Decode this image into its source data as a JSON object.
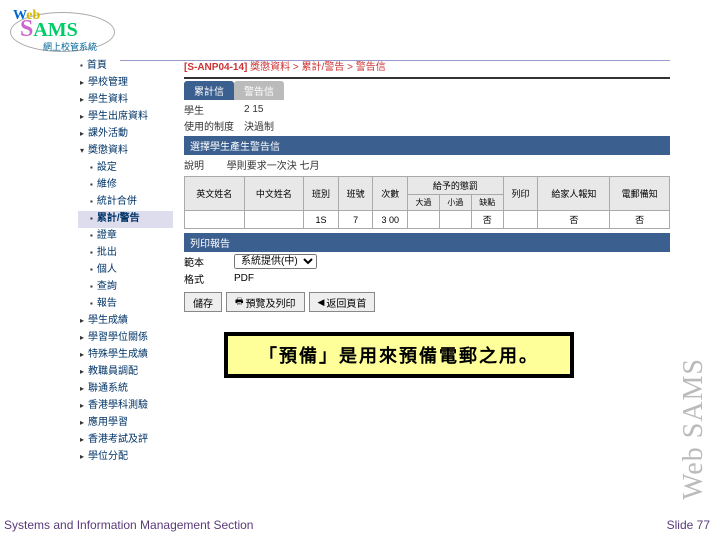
{
  "logo": {
    "web": "Web",
    "sams": "SAMS",
    "cn": "網上校管系統"
  },
  "sidebar": {
    "items": [
      {
        "label": "首頁",
        "type": "bullet"
      },
      {
        "label": "學校管理",
        "type": "arrow"
      },
      {
        "label": "學生資料",
        "type": "arrow"
      },
      {
        "label": "學生出席資料",
        "type": "arrow"
      },
      {
        "label": "課外活動",
        "type": "arrow"
      },
      {
        "label": "獎懲資料",
        "type": "open"
      },
      {
        "label": "設定",
        "type": "bullet",
        "child": true
      },
      {
        "label": "維修",
        "type": "bullet",
        "child": true
      },
      {
        "label": "統計合併",
        "type": "bullet",
        "child": true
      },
      {
        "label": "累計/警告",
        "type": "bullet",
        "child": true,
        "active": true
      },
      {
        "label": "證章",
        "type": "bullet",
        "child": true
      },
      {
        "label": "批出",
        "type": "bullet",
        "child": true
      },
      {
        "label": "個人",
        "type": "bullet",
        "child": true
      },
      {
        "label": "查詢",
        "type": "bullet",
        "child": true
      },
      {
        "label": "報告",
        "type": "bullet",
        "child": true
      },
      {
        "label": "學生成績",
        "type": "arrow"
      },
      {
        "label": "學習學位關係",
        "type": "arrow"
      },
      {
        "label": "特殊學生成績",
        "type": "arrow"
      },
      {
        "label": "教職員調配",
        "type": "arrow"
      },
      {
        "label": "聯通系統",
        "type": "arrow"
      },
      {
        "label": "香港學科測驗",
        "type": "arrow"
      },
      {
        "label": "應用學習",
        "type": "arrow"
      },
      {
        "label": "香港考試及評",
        "type": "arrow"
      },
      {
        "label": "學位分配",
        "type": "arrow"
      }
    ]
  },
  "main": {
    "breadcrumb_code": "[S-ANP04-14]",
    "breadcrumb_path": "獎懲資料 > 累計/警告 > 警告信",
    "tabs": [
      {
        "label": "累計信",
        "active": true
      },
      {
        "label": "警告信",
        "active": false
      }
    ],
    "info": [
      {
        "label": "學生",
        "value": "2 15"
      },
      {
        "label": "使用的制度",
        "value": "決過制"
      }
    ],
    "banner": "選擇學生產生警告信",
    "hint_label": "說明",
    "hint_text": "學則要求一次決 七月",
    "table": {
      "headers_row1": [
        "英文姓名",
        "中文姓名",
        "班別",
        "班號",
        "次數",
        "給予的懲罰",
        "列印",
        "給家人報知",
        "電郵備知"
      ],
      "headers_row2": [
        "",
        "",
        "",
        "",
        "",
        "大過",
        "小過",
        "缺點",
        "",
        "",
        ""
      ],
      "row": [
        "",
        "",
        "1S",
        "7",
        "3 00",
        "",
        "",
        "否",
        "",
        "否",
        "否"
      ]
    },
    "print_section": "列印報告",
    "template_label": "範本",
    "template_value": "系統提供(中)",
    "format_label": "格式",
    "format_value": "PDF",
    "buttons": [
      {
        "label": "儲存",
        "icon": ""
      },
      {
        "label": "預覽及列印",
        "icon": "🖶"
      },
      {
        "label": "返回頁首",
        "icon": "◀"
      }
    ]
  },
  "callout": "「預備」是用來預備電郵之用。",
  "vtext": "Web SAMS",
  "footer": {
    "left": "Systems and Information Management Section",
    "right": "Slide 77"
  }
}
